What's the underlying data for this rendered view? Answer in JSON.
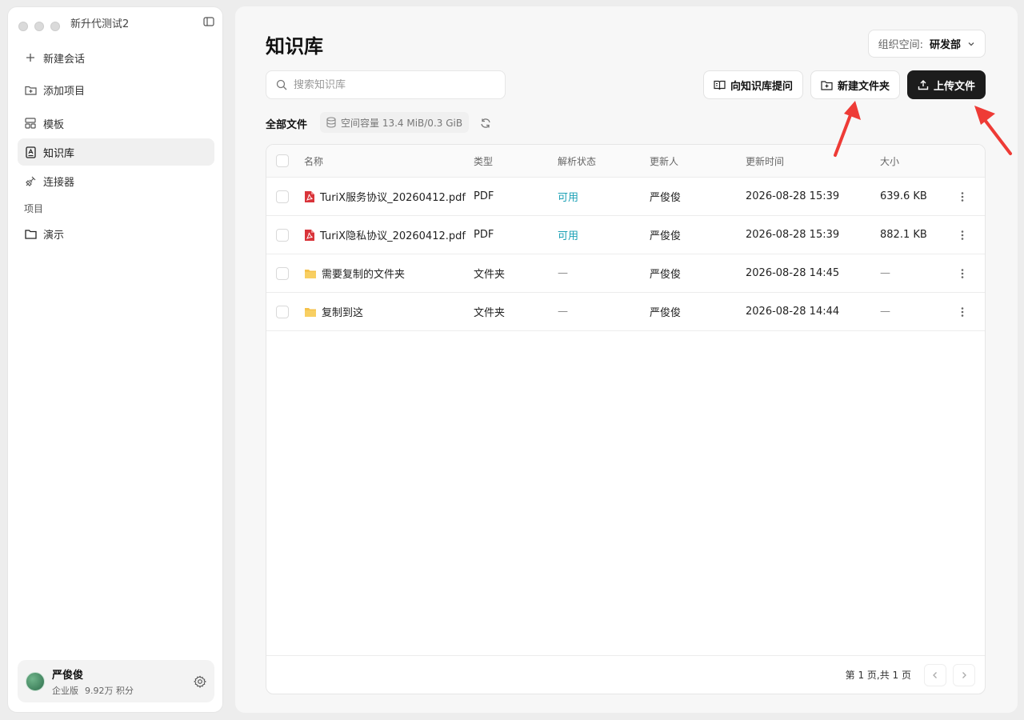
{
  "window": {
    "title": "新升代测试2"
  },
  "sidebar": {
    "items": [
      {
        "label": "新建会话",
        "icon": "plus-icon"
      },
      {
        "label": "添加项目",
        "icon": "folder-add-icon"
      }
    ],
    "nav": [
      {
        "label": "模板",
        "icon": "template-icon"
      },
      {
        "label": "知识库",
        "icon": "knowledge-icon",
        "active": true
      },
      {
        "label": "连接器",
        "icon": "plug-icon"
      }
    ],
    "section_label": "项目",
    "projects": [
      {
        "label": "演示",
        "icon": "folder-icon"
      }
    ],
    "profile": {
      "name": "严俊俊",
      "plan": "企业版",
      "points": "9.92万 积分"
    }
  },
  "main": {
    "title": "知识库",
    "org": {
      "label": "组织空间:",
      "value": "研发部"
    },
    "search": {
      "placeholder": "搜索知识库"
    },
    "buttons": {
      "ask": "向知识库提问",
      "new_folder": "新建文件夹",
      "upload": "上传文件"
    },
    "all_files": "全部文件",
    "capacity": "空间容量 13.4 MiB/0.3 GiB",
    "table": {
      "headers": {
        "name": "名称",
        "type": "类型",
        "status": "解析状态",
        "user": "更新人",
        "time": "更新时间",
        "size": "大小"
      },
      "rows": [
        {
          "kind": "pdf",
          "name": "TuriX服务协议_20260412.pdf",
          "type": "PDF",
          "status": "可用",
          "user": "严俊俊",
          "time": "2026-08-28 15:39",
          "size": "639.6 KB"
        },
        {
          "kind": "pdf",
          "name": "TuriX隐私协议_20260412.pdf",
          "type": "PDF",
          "status": "可用",
          "user": "严俊俊",
          "time": "2026-08-28 15:39",
          "size": "882.1 KB"
        },
        {
          "kind": "folder",
          "name": "需要复制的文件夹",
          "type": "文件夹",
          "status": "—",
          "user": "严俊俊",
          "time": "2026-08-28 14:45",
          "size": "—"
        },
        {
          "kind": "folder",
          "name": "复制到这",
          "type": "文件夹",
          "status": "—",
          "user": "严俊俊",
          "time": "2026-08-28 14:44",
          "size": "—"
        }
      ]
    },
    "pager": {
      "text": "第 1 页,共 1 页"
    }
  },
  "colors": {
    "accent": "#1aa0b5",
    "primary_button": "#1c1c1c",
    "pdf": "#d9343a",
    "folder": "#f5c24b",
    "annotation_arrow": "#ee3b36"
  }
}
